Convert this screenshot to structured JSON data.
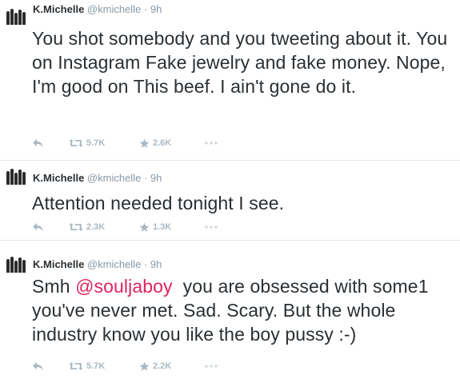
{
  "tweets": [
    {
      "name": "K.Michelle",
      "handle": "@kmichelle",
      "separator": "·",
      "time": "9h",
      "text_before": "You shot somebody and you tweeting about it. You on Instagram Fake jewelry and fake money. Nope, I'm good on This beef. I ain't gone do it.",
      "mention": "",
      "text_after": "",
      "retweets": "5.7K",
      "favorites": "2.6K"
    },
    {
      "name": "K.Michelle",
      "handle": "@kmichelle",
      "separator": "·",
      "time": "9h",
      "text_before": "Attention needed tonight I see.",
      "mention": "",
      "text_after": "",
      "retweets": "2.3K",
      "favorites": "1.3K"
    },
    {
      "name": "K.Michelle",
      "handle": "@kmichelle",
      "separator": "·",
      "time": "9h",
      "text_before": "Smh ",
      "mention": "@souljaboy",
      "text_after": "  you are obsessed with some1 you've never met. Sad. Scary. But the whole industry know you like the boy pussy :-)",
      "retweets": "5.7K",
      "favorites": "2.2K"
    }
  ],
  "icons": {
    "reply": "reply-icon",
    "retweet": "retweet-icon",
    "favorite": "star-icon",
    "more": "more-icon"
  },
  "colors": {
    "text": "#292f33",
    "muted": "#8899a6",
    "action": "#aab8c2",
    "mention": "#e0245e",
    "divider": "#e1e8ed"
  }
}
